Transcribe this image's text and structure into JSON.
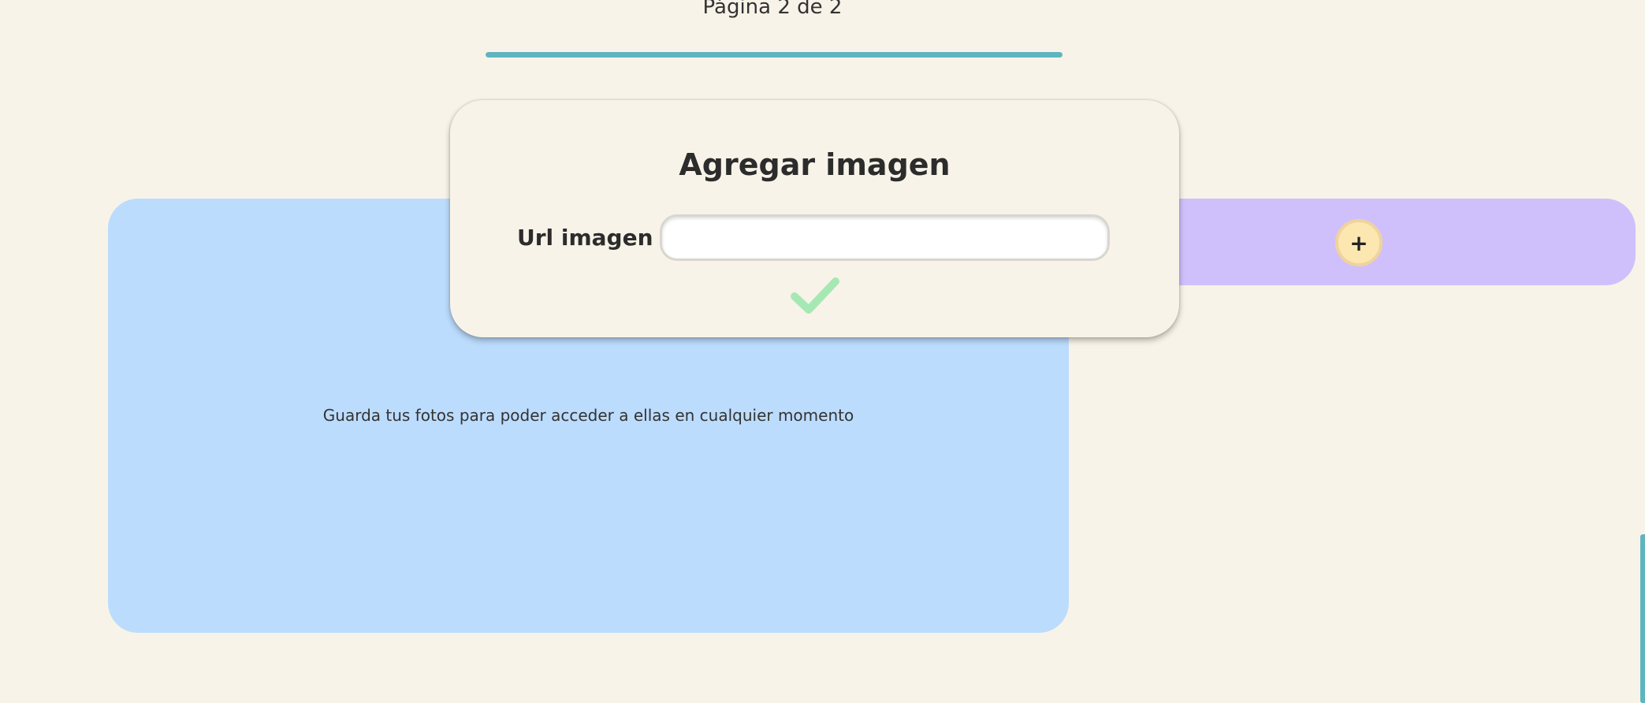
{
  "pagination": {
    "label": "Página 2 de 2",
    "progress_fraction": 1.0,
    "accent_color": "#5fb5bf"
  },
  "album": {
    "empty_message": "Guarda tus fotos para poder acceder a ellas en cualquier momento",
    "panel_color": "#bcdcfd"
  },
  "add_strip": {
    "button_label": "+",
    "strip_color": "#cfc0fb",
    "button_color": "#fde7b1"
  },
  "modal": {
    "title": "Agregar imagen",
    "field_label": "Url imagen",
    "url_value": "",
    "url_placeholder": "",
    "confirm_icon": "checkmark-icon",
    "confirm_color": "#a6e8b4"
  },
  "colors": {
    "background": "#f8f3e8"
  }
}
